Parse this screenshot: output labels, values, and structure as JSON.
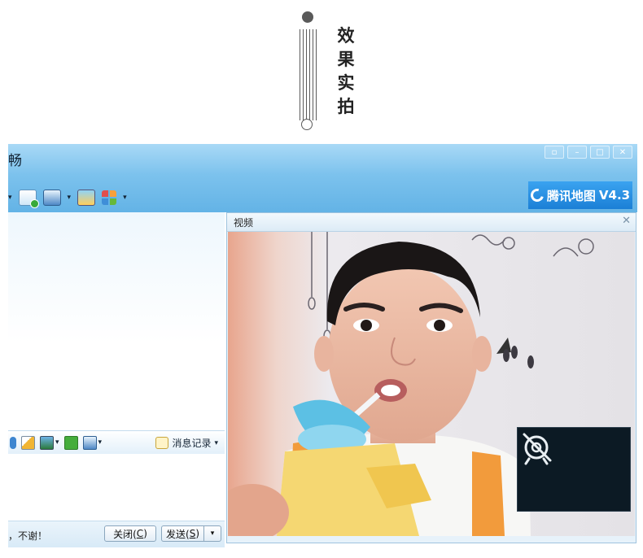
{
  "header": {
    "title": "效果实拍"
  },
  "window": {
    "title": "畅",
    "controls": [
      "▫",
      "–",
      "□",
      "✕"
    ]
  },
  "brand": {
    "name": "腾讯地图",
    "version": "V4.3"
  },
  "toolbar": {
    "arrow": "▾"
  },
  "input_bar": {
    "history_label": "消息记录",
    "arrow": "▾"
  },
  "bottom": {
    "tip": "，不谢！",
    "close_prefix": "关闭(",
    "close_key": "C",
    "close_suffix": ")",
    "send_prefix": "发送(",
    "send_key": "S",
    "send_suffix": ")",
    "dropdown": "▾"
  },
  "video": {
    "title": "视频",
    "close": "✕"
  },
  "colors": {
    "titlebar": "#7cc2ed",
    "brand": "#1b7fd6",
    "accent": "#3e86d0"
  }
}
